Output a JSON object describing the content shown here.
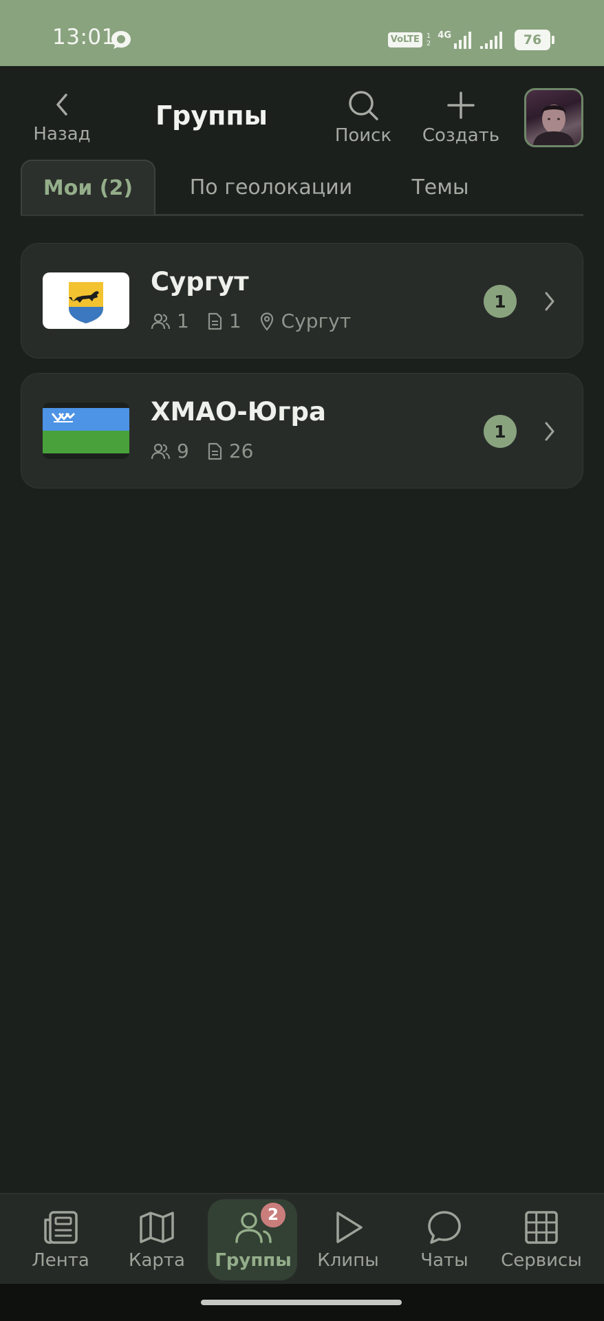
{
  "status_bar": {
    "time": "13:01",
    "volte": "VoLTE",
    "sim_labels": [
      "1",
      "2"
    ],
    "network": "4G",
    "battery": "76"
  },
  "header": {
    "back_label": "Назад",
    "title": "Группы",
    "search_label": "Поиск",
    "create_label": "Создать"
  },
  "tabs": [
    {
      "label": "Мои (2)",
      "active": true
    },
    {
      "label": "По геолокации",
      "active": false
    },
    {
      "label": "Темы",
      "active": false
    }
  ],
  "groups": [
    {
      "name": "Сургут",
      "members": "1",
      "posts": "1",
      "location": "Сургут",
      "unread": "1",
      "logo": "surgut-coat-of-arms"
    },
    {
      "name": "ХМАО-Югра",
      "members": "9",
      "posts": "26",
      "unread": "1",
      "logo": "khmao-flag"
    }
  ],
  "bottom_nav": [
    {
      "label": "Лента",
      "icon": "news-icon"
    },
    {
      "label": "Карта",
      "icon": "map-icon"
    },
    {
      "label": "Группы",
      "icon": "users-icon",
      "active": true,
      "badge": "2"
    },
    {
      "label": "Клипы",
      "icon": "play-icon"
    },
    {
      "label": "Чаты",
      "icon": "chat-icon"
    },
    {
      "label": "Сервисы",
      "icon": "grid-icon"
    }
  ],
  "colors": {
    "accent": "#8aa37f",
    "background": "#1c201d",
    "card": "#282c29",
    "badge_red": "#c97e7c"
  }
}
